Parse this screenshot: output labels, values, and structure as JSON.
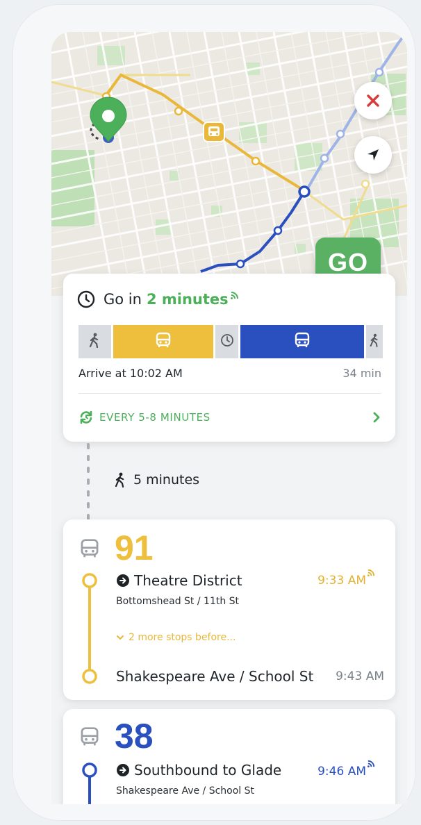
{
  "colors": {
    "green": "#4caf5a",
    "go_green": "#5ab164",
    "yellow": "#eebf3c",
    "blue": "#2a4fbf",
    "grey": "#b9bec4"
  },
  "map": {
    "close_icon": "close-icon",
    "locate_icon": "navigation-arrow-icon",
    "go_label": "GO"
  },
  "summary": {
    "prefix": "Go in",
    "minutes": "2 minutes",
    "arrive": "Arrive at 10:02 AM",
    "duration": "34 min",
    "frequency": "EVERY 5-8 MINUTES"
  },
  "walk": {
    "label": "5 minutes"
  },
  "legs": [
    {
      "route": "91",
      "board_stop": "Theatre District",
      "board_sub": "Bottomshead St / 11th St",
      "board_time": "9:33 AM",
      "more_stops": "2 more stops before...",
      "alight_stop": "Shakespeare Ave / School St",
      "alight_time": "9:43 AM"
    },
    {
      "route": "38",
      "board_stop": "Southbound to Glade",
      "board_sub": "Shakespeare Ave / School St",
      "board_time": "9:46 AM"
    }
  ]
}
